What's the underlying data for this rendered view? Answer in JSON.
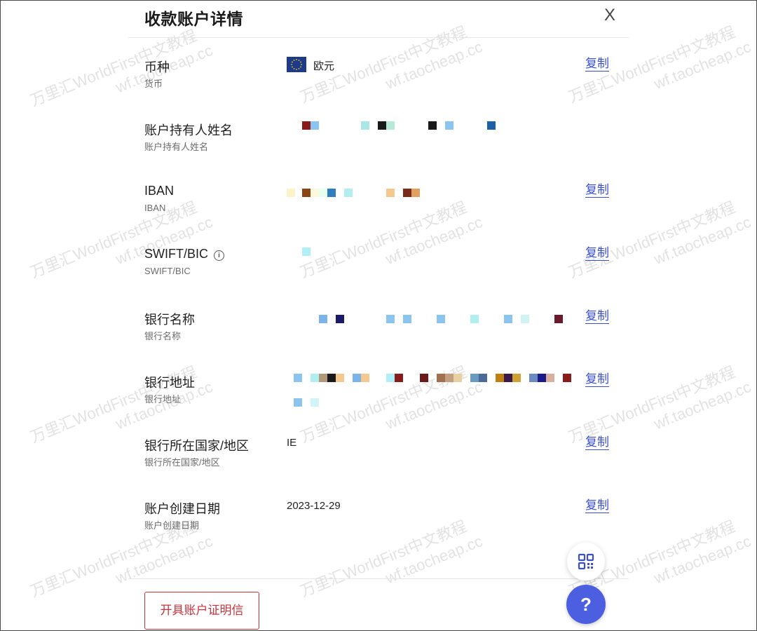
{
  "dialog": {
    "title": "收款账户详情",
    "close_label": "X"
  },
  "fields": [
    {
      "label": "币种",
      "sublabel": "货币",
      "value": "欧元",
      "has_copy": true
    },
    {
      "label": "账户持有人姓名",
      "sublabel": "账户持有人姓名",
      "value": "",
      "has_copy": false
    },
    {
      "label": "IBAN",
      "sublabel": "IBAN",
      "value": "",
      "has_copy": true
    },
    {
      "label": "SWIFT/BIC",
      "sublabel": "SWIFT/BIC",
      "value": "",
      "has_copy": true
    },
    {
      "label": "银行名称",
      "sublabel": "银行名称",
      "value": "",
      "has_copy": true
    },
    {
      "label": "银行地址",
      "sublabel": "银行地址",
      "value": "",
      "has_copy": true
    },
    {
      "label": "银行所在国家/地区",
      "sublabel": "银行所在国家/地区",
      "value": "IE",
      "has_copy": true
    },
    {
      "label": "账户创建日期",
      "sublabel": "账户创建日期",
      "value": "2023-12-29",
      "has_copy": true
    }
  ],
  "copy_label": "复制",
  "info_glyph": "i",
  "certificate_button": "开具账户证明信",
  "help_glyph": "?",
  "watermark": {
    "line1": "万里汇WorldFirst中文教程",
    "line2": "wf.taocheap.cc"
  },
  "colors": {
    "accent": "#3a4fc9",
    "danger": "#c8323b",
    "fab": "#4c5fe0",
    "eu_flag": "#1e3a8a"
  },
  "icons": {
    "close": "close-icon",
    "info": "info-icon",
    "qr": "qr-code-icon",
    "help": "help-icon",
    "flag": "eu-flag-icon"
  }
}
